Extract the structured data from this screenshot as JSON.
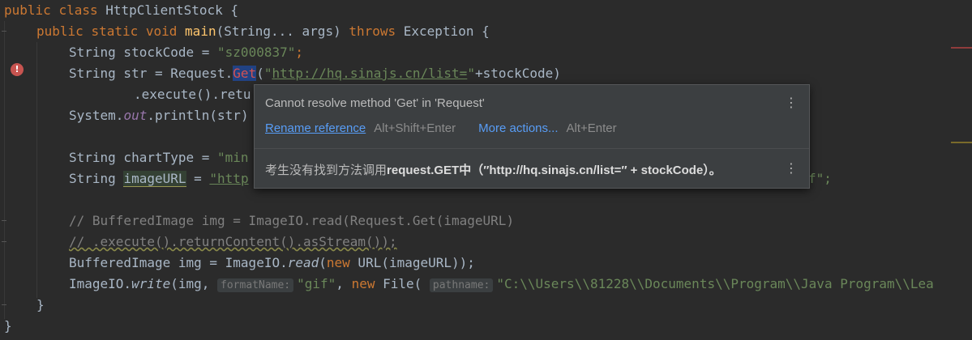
{
  "code": {
    "l1": {
      "kw1": "public",
      "kw2": "class",
      "name": "HttpClientStock",
      "brace": " {"
    },
    "l2": {
      "kw1": "public",
      "kw2": "static",
      "kw3": "void",
      "method": "main",
      "params_a": "(String... args) ",
      "throws": "throws",
      "exc": " Exception {"
    },
    "l3": {
      "decl": "String stockCode = ",
      "val": "\"sz000837\"",
      "end": ";"
    },
    "l4": {
      "decl": "String str = Request.",
      "get": "Get",
      "open": "(",
      "q1": "\"",
      "url": "http://hq.sinajs.cn/list=",
      "q2": "\"",
      "rest": "+stockCode)"
    },
    "l5": {
      "text": ".execute().retu"
    },
    "l6": {
      "a": "System.",
      "out": "out",
      "b": ".println(str)"
    },
    "l7": {
      "decl": "String chartType = ",
      "val": "\"min"
    },
    "l8": {
      "decl": "String ",
      "var": "imageURL",
      "eq": " = ",
      "val": "\"http",
      "tail": "f\";"
    },
    "l9": {
      "text": "// BufferedImage img = ImageIO.read(Request.Get(imageURL)"
    },
    "l10": {
      "text": "// .execute().returnContent().asStream());"
    },
    "l11": {
      "a": "BufferedImage img = ImageIO.",
      "read": "read",
      "b": "(",
      "new": "new",
      "c": " URL(imageURL));"
    },
    "l12": {
      "a": "ImageIO.",
      "write": "write",
      "b": "(img, ",
      "hint1": "formatName:",
      "gif": "\"gif\"",
      "c": ", ",
      "new": "new",
      "d": " File( ",
      "hint2": "pathname:",
      "path": "\"C:\\\\Users\\\\81228\\\\Documents\\\\Program\\\\Java Program\\\\Lea"
    },
    "l13": {
      "text": "}"
    },
    "l14": {
      "text": "}"
    }
  },
  "popup": {
    "message": "Cannot resolve method 'Get' in 'Request'",
    "action1": "Rename reference",
    "shortcut1": "Alt+Shift+Enter",
    "action2": "More actions...",
    "shortcut2": "Alt+Enter",
    "translation_a": "考生没有找到方法调用",
    "translation_b": "request.GET中",
    "translation_c": "（″http://hq.sinajs.cn/list=″ + stockCode）。",
    "kebab": "⋮"
  },
  "gutter": {
    "error_icon": "!"
  },
  "colors": {
    "keyword": "#cc7832",
    "string": "#6a8759",
    "comment": "#808080",
    "error": "#d25252",
    "link": "#589df6"
  }
}
